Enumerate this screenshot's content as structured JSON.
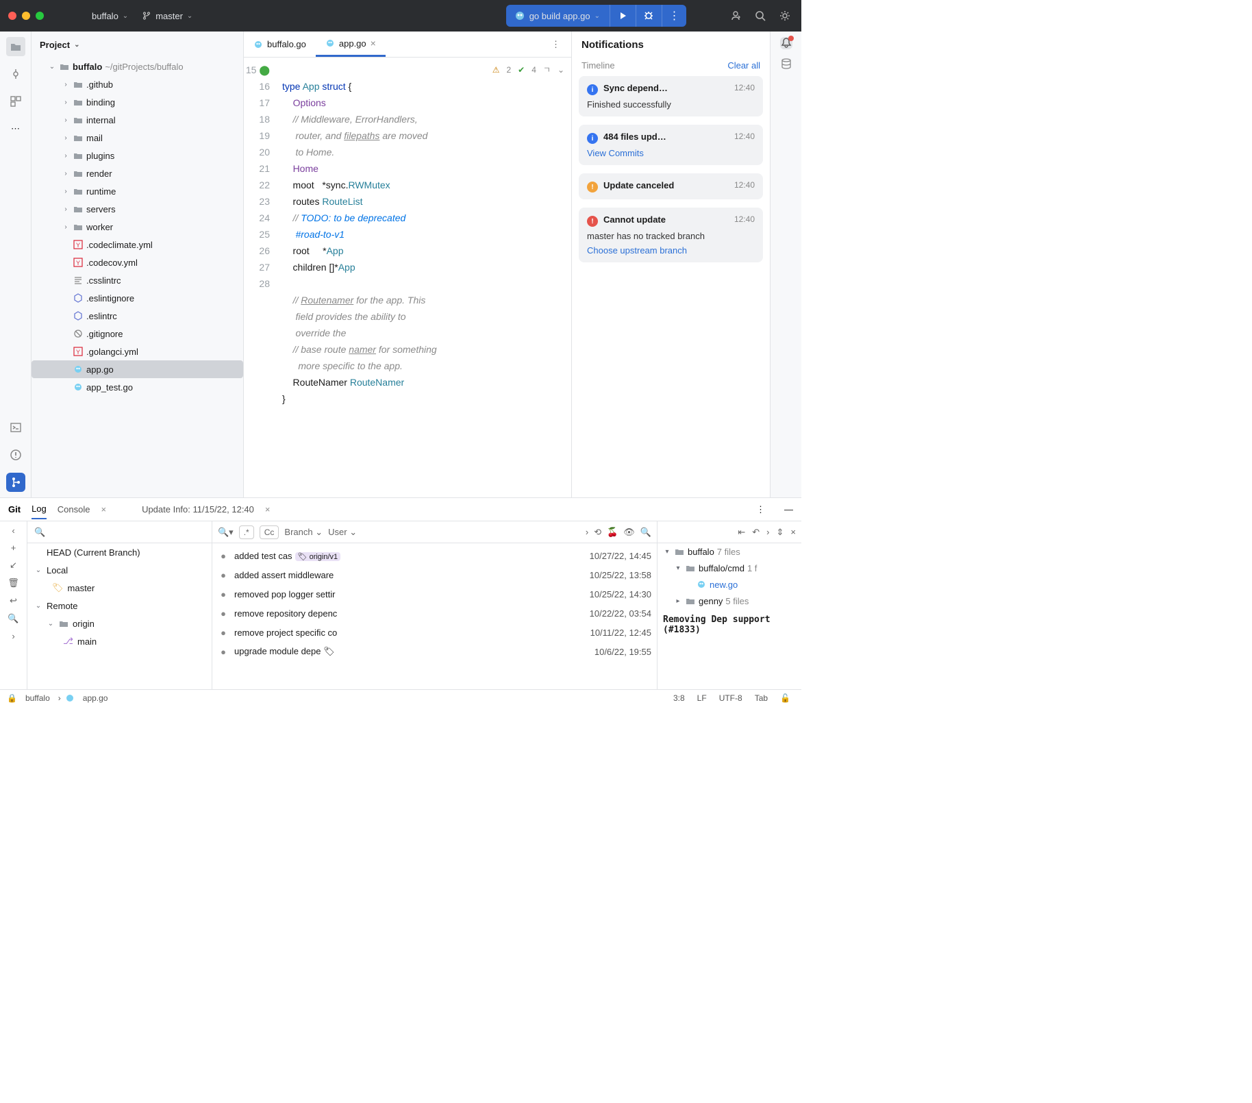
{
  "titlebar": {
    "project": "buffalo",
    "branch": "master",
    "run_config": "go build app.go"
  },
  "project_panel": {
    "title": "Project",
    "root": {
      "name": "buffalo",
      "path": "~/gitProjects/buffalo"
    },
    "folders": [
      ".github",
      "binding",
      "internal",
      "mail",
      "plugins",
      "render",
      "runtime",
      "servers",
      "worker"
    ],
    "files": [
      {
        "name": ".codeclimate.yml",
        "ico": "yml-red"
      },
      {
        "name": ".codecov.yml",
        "ico": "yml-red"
      },
      {
        "name": ".csslintrc",
        "ico": "lines"
      },
      {
        "name": ".eslintignore",
        "ico": "hex"
      },
      {
        "name": ".eslintrc",
        "ico": "hex"
      },
      {
        "name": ".gitignore",
        "ico": "ignore"
      },
      {
        "name": ".golangci.yml",
        "ico": "yml-red"
      },
      {
        "name": "app.go",
        "ico": "go",
        "selected": true
      },
      {
        "name": "app_test.go",
        "ico": "go"
      }
    ]
  },
  "tabs": [
    {
      "label": "buffalo.go",
      "active": false
    },
    {
      "label": "app.go",
      "active": true
    }
  ],
  "inspection": {
    "warn": "2",
    "ok": "4"
  },
  "gutter_lines": [
    "15",
    "16",
    "17",
    "",
    "",
    "18",
    "19",
    "20",
    "21",
    "",
    "22",
    "23",
    "24",
    "25",
    "",
    "26",
    "",
    "27",
    "28"
  ],
  "notifications": {
    "title": "Notifications",
    "timeline": "Timeline",
    "clear": "Clear all",
    "items": [
      {
        "kind": "info",
        "title": "Sync depend…",
        "time": "12:40",
        "body": "Finished successfully"
      },
      {
        "kind": "info",
        "title": "484 files upd…",
        "time": "12:40",
        "link": "View Commits"
      },
      {
        "kind": "warn",
        "title": "Update canceled",
        "time": "12:40"
      },
      {
        "kind": "error",
        "title": "Cannot update",
        "time": "12:40",
        "body": "master has no tracked branch",
        "link": "Choose upstream branch"
      }
    ]
  },
  "bottom": {
    "tab_git": "Git",
    "tab_log": "Log",
    "tab_console": "Console",
    "update_info": "Update Info: 11/15/22, 12:40",
    "branches": {
      "head": "HEAD (Current Branch)",
      "local": "Local",
      "local_master": "master",
      "remote": "Remote",
      "origin": "origin",
      "main": "main"
    },
    "commit_filters": {
      "branch": "Branch",
      "user": "User",
      "regex_label": ".*",
      "cc_label": "Cc"
    },
    "commits": [
      {
        "msg": "added test cas",
        "tag": "origin/v1",
        "date": "10/27/22, 14:45"
      },
      {
        "msg": "added assert middleware",
        "date": "10/25/22, 13:58"
      },
      {
        "msg": "removed pop logger settir",
        "date": "10/25/22, 14:30"
      },
      {
        "msg": "remove repository depenc",
        "date": "10/22/22, 03:54"
      },
      {
        "msg": "remove project specific co",
        "date": "10/11/22, 12:45"
      },
      {
        "msg": "upgrade module depe",
        "date": "10/6/22, 19:55",
        "hasTag": true
      }
    ],
    "diff": {
      "items": [
        {
          "name": "buffalo",
          "count": "7 files",
          "indent": 0,
          "chev": "▾"
        },
        {
          "name": "buffalo/cmd",
          "count": "1 f",
          "indent": 1,
          "chev": "▾"
        },
        {
          "name": "new.go",
          "indent": 2,
          "go": true
        },
        {
          "name": "genny",
          "count": "5 files",
          "indent": 1,
          "chev": "▸"
        }
      ],
      "commit_msg": "Removing Dep support (#1833)"
    }
  },
  "breadcrumb": {
    "root": "buffalo",
    "file": "app.go"
  },
  "statusbar": {
    "pos": "3:8",
    "sep": "LF",
    "enc": "UTF-8",
    "indent": "Tab"
  }
}
